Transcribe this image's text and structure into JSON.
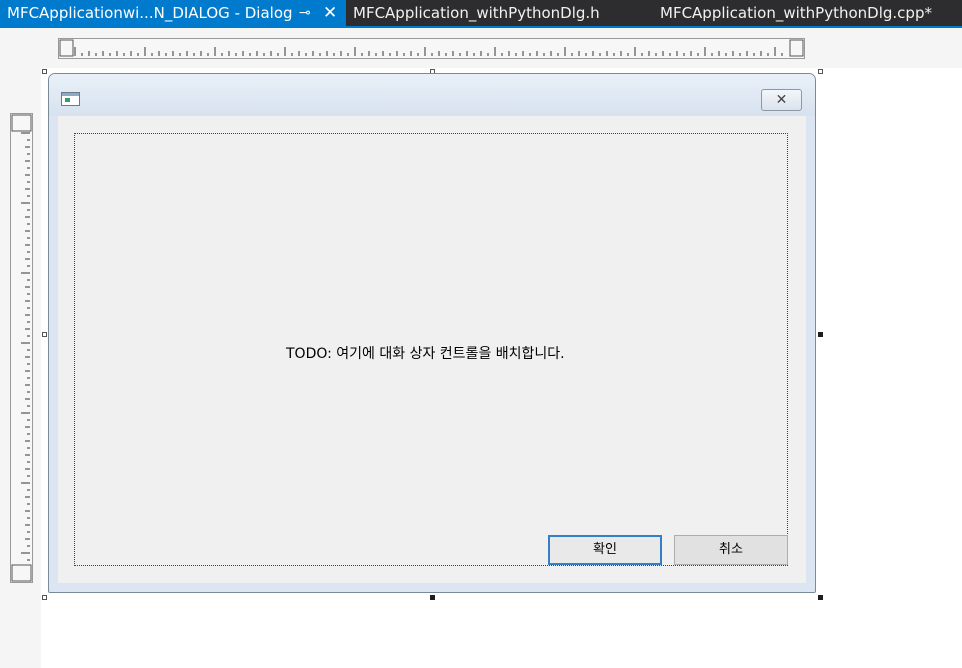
{
  "tabs": [
    {
      "label": "MFCApplicationwi...N_DIALOG - Dialog",
      "active": true,
      "pin_icon": "pin-icon",
      "close_icon": "close-icon"
    },
    {
      "label": "MFCApplication_withPythonDlg.h",
      "active": false
    },
    {
      "label": "MFCApplication_withPythonDlg.cpp*",
      "active": false
    }
  ],
  "tab_glyphs": {
    "pin": "⊸",
    "close": "✕"
  },
  "dialog": {
    "caption_icon": "dialog-app-icon",
    "close_glyph": "✕",
    "todo_text": "TODO: 여기에 대화 상자 컨트롤을 배치합니다.",
    "ok_label": "확인",
    "cancel_label": "취소"
  },
  "colors": {
    "tab_strip": "#2d2d30",
    "active_tab": "#007acc",
    "guide_line": "#3030c0",
    "default_button_border": "#3380c6"
  }
}
